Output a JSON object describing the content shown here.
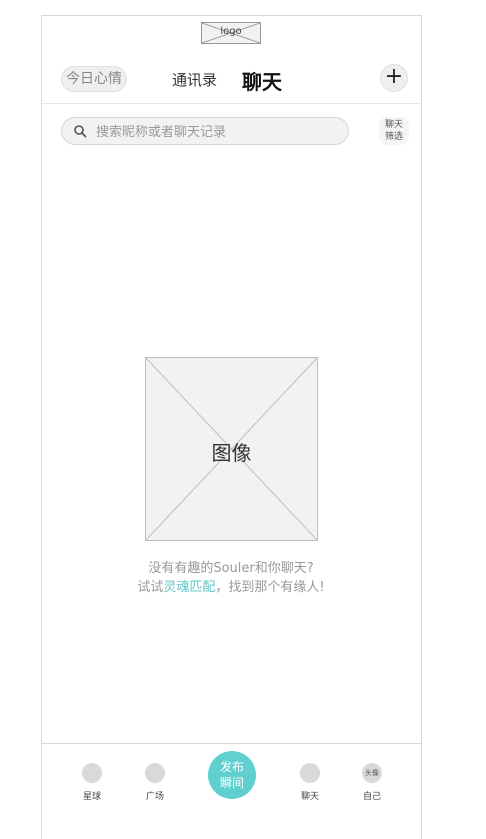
{
  "header": {
    "logo_text": "logo",
    "mood_button": "今日心情",
    "tab_contacts": "通讯录",
    "tab_chat": "聊天",
    "plus_icon": "+"
  },
  "search": {
    "placeholder": "搜索昵称或者聊天记录",
    "filter_line1": "聊天",
    "filter_line2": "筛选"
  },
  "empty_state": {
    "image_label": "图像",
    "line1": "没有有趣的Souler和你聊天?",
    "line2_prefix": "试试",
    "line2_link": "灵魂匹配",
    "line2_suffix": "，找到那个有缘人!"
  },
  "bottom_nav": {
    "items": [
      {
        "label": "星球"
      },
      {
        "label": "广场"
      },
      {
        "label": "聊天"
      },
      {
        "label": "自己",
        "avatar_text": "头像"
      }
    ],
    "publish_line1": "发布",
    "publish_line2": "瞬间"
  },
  "colors": {
    "accent": "#5fcfcf",
    "link": "#5fc8c8"
  }
}
